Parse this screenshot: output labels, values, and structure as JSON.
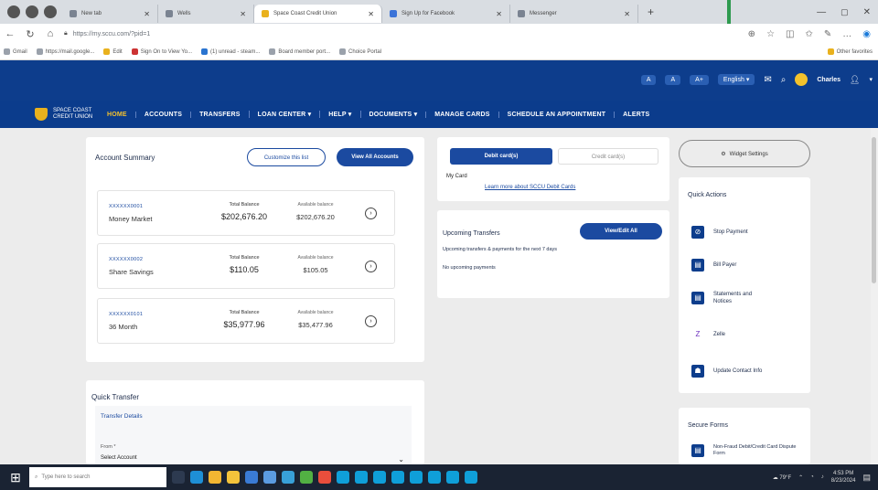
{
  "browser": {
    "tabs": [
      {
        "label": "New tab",
        "active": false
      },
      {
        "label": "Wells",
        "active": false
      },
      {
        "label": "Space Coast Credit Union",
        "active": true
      },
      {
        "label": "Sign Up for Facebook",
        "active": false
      },
      {
        "label": "Messenger",
        "active": false
      }
    ],
    "url": "https://my.sccu.com/?pid=1",
    "bookmarks": [
      "Gmail",
      "https://mail.google...",
      "Edit",
      "Sign On to View Yo...",
      "(1) unread - steam...",
      "Board member port...",
      "Choice Portal"
    ],
    "other_favorites": "Other favorites"
  },
  "site": {
    "logo_line1": "SPACE COAST",
    "logo_line2": "CREDIT UNION",
    "util": {
      "font_small": "A",
      "font_med": "A",
      "font_large": "A+",
      "language": "English",
      "user": "Charles"
    },
    "nav": [
      "HOME",
      "ACCOUNTS",
      "TRANSFERS",
      "LOAN CENTER",
      "HELP",
      "DOCUMENTS",
      "MANAGE CARDS",
      "SCHEDULE AN APPOINTMENT",
      "ALERTS"
    ]
  },
  "summary": {
    "title": "Account Summary",
    "customize_btn": "Customize this list",
    "view_all_btn": "View All Accounts",
    "total_label": "Total Balance",
    "avail_label": "Available balance",
    "accounts": [
      {
        "number": "XXXXXX0001",
        "name": "Money Market",
        "total": "$202,676.20",
        "available": "$202,676.20"
      },
      {
        "number": "XXXXXX0002",
        "name": "Share Savings",
        "total": "$110.05",
        "available": "$105.05"
      },
      {
        "number": "XXXXXX0101",
        "name": "36 Month",
        "total": "$35,977.96",
        "available": "$35,477.96"
      }
    ]
  },
  "quick_transfer": {
    "title": "Quick Transfer",
    "details": "Transfer Details",
    "from_label": "From *",
    "select": "Select Account"
  },
  "cards": {
    "tab_debit": "Debit card(s)",
    "tab_credit": "Credit card(s)",
    "my_card": "My Card",
    "learn_more": "Learn more about SCCU Debit Cards"
  },
  "upcoming": {
    "title": "Upcoming Transfers",
    "view_btn": "View/Edit All",
    "subtitle": "Upcoming transfers & payments for the next 7 days",
    "empty": "No upcoming payments"
  },
  "widget_settings": "Widget Settings",
  "quick_actions": {
    "title": "Quick Actions",
    "items": [
      {
        "icon": "stop-icon",
        "label": "Stop Payment"
      },
      {
        "icon": "bill-icon",
        "label": "Bill Payer"
      },
      {
        "icon": "document-icon",
        "label": "Statements and Notices"
      },
      {
        "icon": "zelle-icon",
        "label": "Zelle"
      },
      {
        "icon": "person-icon",
        "label": "Update Contact Info"
      }
    ]
  },
  "secure_forms": {
    "title": "Secure Forms",
    "item": "Non-Fraud Debit/Credit Card Dispute Form"
  },
  "taskbar": {
    "search_placeholder": "Type here to search",
    "weather": "79°F",
    "time": "4:53 PM",
    "date": "8/23/2024"
  },
  "colors": {
    "navy": "#0d3d8c",
    "gold": "#f2c12e",
    "button_blue": "#1b4aa0"
  }
}
